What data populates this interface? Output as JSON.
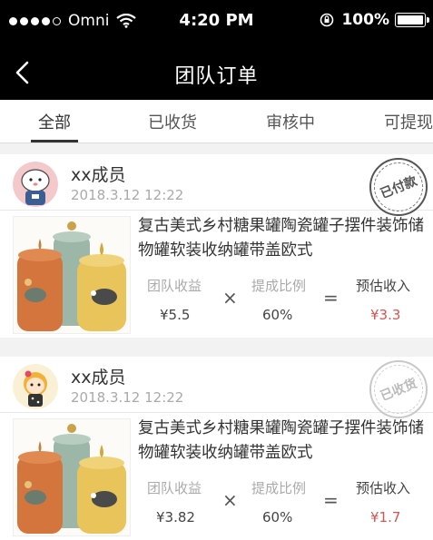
{
  "status_bar": {
    "carrier": "Omni",
    "time": "4:20 PM",
    "battery": "100%"
  },
  "nav": {
    "title": "团队订单"
  },
  "tabs": [
    {
      "label": "全部",
      "active": true
    },
    {
      "label": "已收货",
      "active": false
    },
    {
      "label": "审核中",
      "active": false
    },
    {
      "label": "可提现",
      "active": false
    }
  ],
  "orders": [
    {
      "member_name": "xx成员",
      "date": "2018.3.12 12:22",
      "stamp": "已付款",
      "product_title": "复古美式乡村糖果罐陶瓷罐子摆件装饰储物罐软装收纳罐带盖欧式",
      "label_income": "团队收益",
      "label_ratio": "提成比例",
      "label_estimate": "预估收入",
      "op_multiply": "×",
      "op_equals": "=",
      "income": "¥5.5",
      "ratio": "60%",
      "estimate": "¥3.3"
    },
    {
      "member_name": "xx成员",
      "date": "2018.3.12 12:22",
      "stamp": "已收货",
      "product_title": "复古美式乡村糖果罐陶瓷罐子摆件装饰储物罐软装收纳罐带盖欧式",
      "label_income": "团队收益",
      "label_ratio": "提成比例",
      "label_estimate": "预估收入",
      "op_multiply": "×",
      "op_equals": "=",
      "income": "¥3.82",
      "ratio": "60%",
      "estimate": "¥1.7"
    }
  ],
  "colors": {
    "accent_red": "#d9534f",
    "bar": "#000000"
  }
}
